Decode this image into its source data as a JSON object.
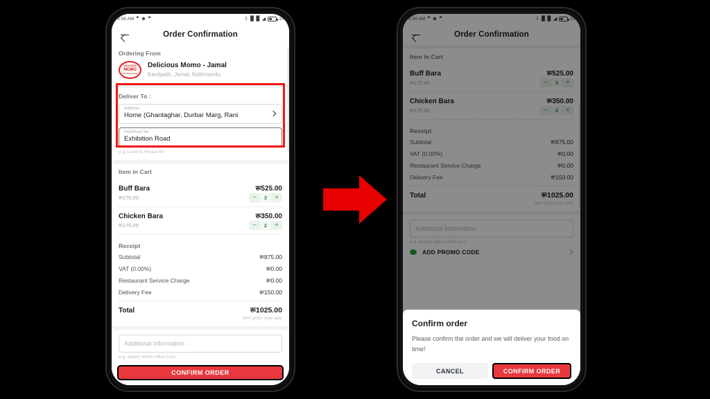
{
  "status_bar": {
    "time": "9:56 AM",
    "notification_icons": [
      "quote-icon",
      "face-icon",
      "quote-icon"
    ],
    "right_icons": [
      "bluetooth-icon",
      "signal-icon",
      "signal-icon",
      "wifi-icon",
      "battery-icon"
    ],
    "battery_percent": "33"
  },
  "appbar": {
    "title": "Order Confirmation",
    "back_icon": "back-arrow-icon"
  },
  "ordering_from": {
    "section_title": "Ordering From",
    "logo_top": "DELICIOUS",
    "logo_mid": "MOMO",
    "logo_bottom": "and Restaurant",
    "name": "Delicious Momo - Jamal",
    "address": "Kantipath, Jamal, Kathmandu"
  },
  "deliver_to": {
    "section_title": "Deliver To :",
    "address_label": "Address",
    "address_value": "Home (Ghantaghar, Durbar Marg, Rani",
    "flat_label": "Flat/Road No",
    "flat_value": "Exhibition Road",
    "flat_hint": "e.g. Level 8, House 68",
    "chevron_icon": "chevron-right-icon",
    "highlight_color": "#f31616"
  },
  "cart": {
    "section_title": "Item in Cart",
    "items": [
      {
        "name": "Buff Bara",
        "line_total": "रू525.00",
        "unit_price": "रू175.00",
        "qty": "3",
        "minus": "−",
        "plus": "+"
      },
      {
        "name": "Chicken Bara",
        "line_total": "रू350.00",
        "unit_price": "रू175.00",
        "qty": "2",
        "minus": "−",
        "plus": "+"
      }
    ]
  },
  "receipt": {
    "section_title": "Receipt",
    "rows": [
      {
        "label": "Subtotal",
        "value": "रू875.00"
      },
      {
        "label": "VAT (0.00%)",
        "value": "रू0.00"
      },
      {
        "label": "Restaurant Service Charge",
        "value": "रू0.00"
      },
      {
        "label": "Delivery Fee",
        "value": "रू150.00"
      }
    ],
    "total_label": "Total",
    "total_value": "रू1025.00",
    "note": "Item price may vary"
  },
  "additional": {
    "placeholder": "Additional Information",
    "hint": "e.g. deliver within office hour"
  },
  "promo": {
    "label": "ADD PROMO CODE",
    "icon": "promo-tag-icon",
    "chevron_icon": "chevron-right-icon"
  },
  "cta": {
    "label": "CONFIRM ORDER"
  },
  "dialog": {
    "title": "Confirm order",
    "body": "Please confirm the order and we will deliver your food on time!",
    "cancel_label": "CANCEL",
    "confirm_label": "CONFIRM ORDER"
  },
  "flow_arrow": {
    "icon": "right-arrow-icon",
    "color": "#e60000"
  }
}
